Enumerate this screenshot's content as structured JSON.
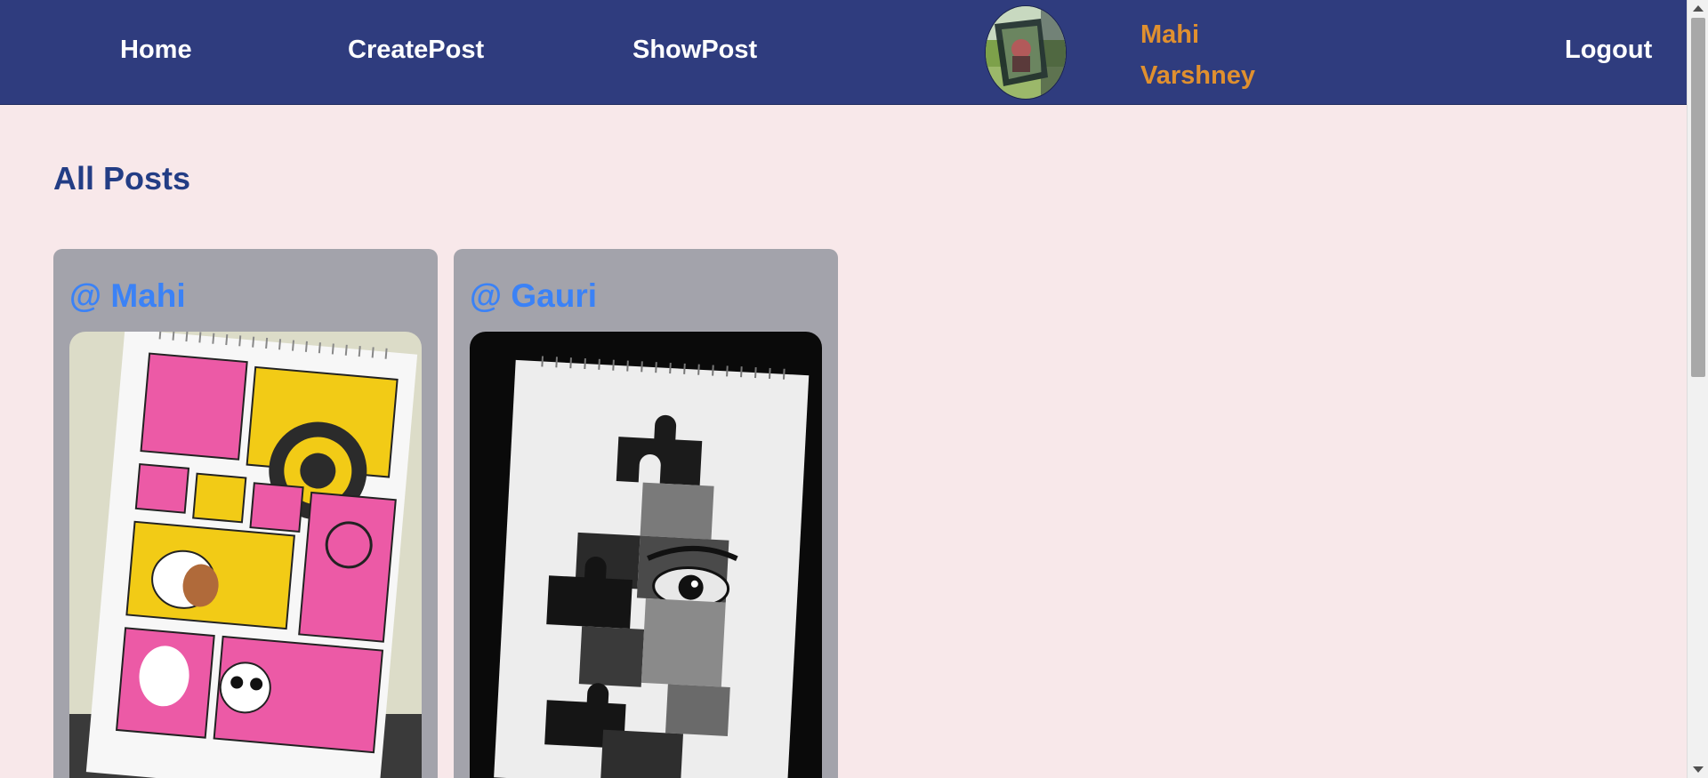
{
  "nav": {
    "home": "Home",
    "create_post": "CreatePost",
    "show_post": "ShowPost",
    "logout": "Logout",
    "user_first": "Mahi",
    "user_last": "Varshney"
  },
  "main": {
    "title": "All Posts",
    "posts": [
      {
        "user": "@ Mahi",
        "image": "sketchbook-self-love-collage"
      },
      {
        "user": "@ Gauri",
        "image": "puzzle-face-sketch"
      }
    ]
  },
  "colors": {
    "navbar": "#2f3c7e",
    "page_bg": "#f8e8ea",
    "username_accent": "#e0902f",
    "card_bg": "#a3a3ab",
    "post_user": "#3b82f6",
    "title": "#233d85"
  }
}
